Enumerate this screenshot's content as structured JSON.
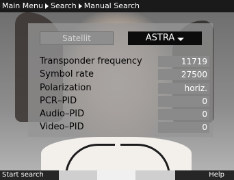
{
  "breadcrumb": {
    "items": [
      "Main Menu",
      "Search",
      "Manual Search"
    ]
  },
  "satellite": {
    "label": "Satellit",
    "selected": "ASTRA"
  },
  "parameters": [
    {
      "label": "Transponder frequency",
      "value": "11719"
    },
    {
      "label": "Symbol rate",
      "value": "27500"
    },
    {
      "label": "Polarization",
      "value": "horiz."
    },
    {
      "label": "PCR–PID",
      "value": "0"
    },
    {
      "label": "Audio–PID",
      "value": "0"
    },
    {
      "label": "Video–PID",
      "value": "0"
    }
  ],
  "bottom_bar": {
    "start_label": "Start search",
    "help_label": "Help"
  }
}
